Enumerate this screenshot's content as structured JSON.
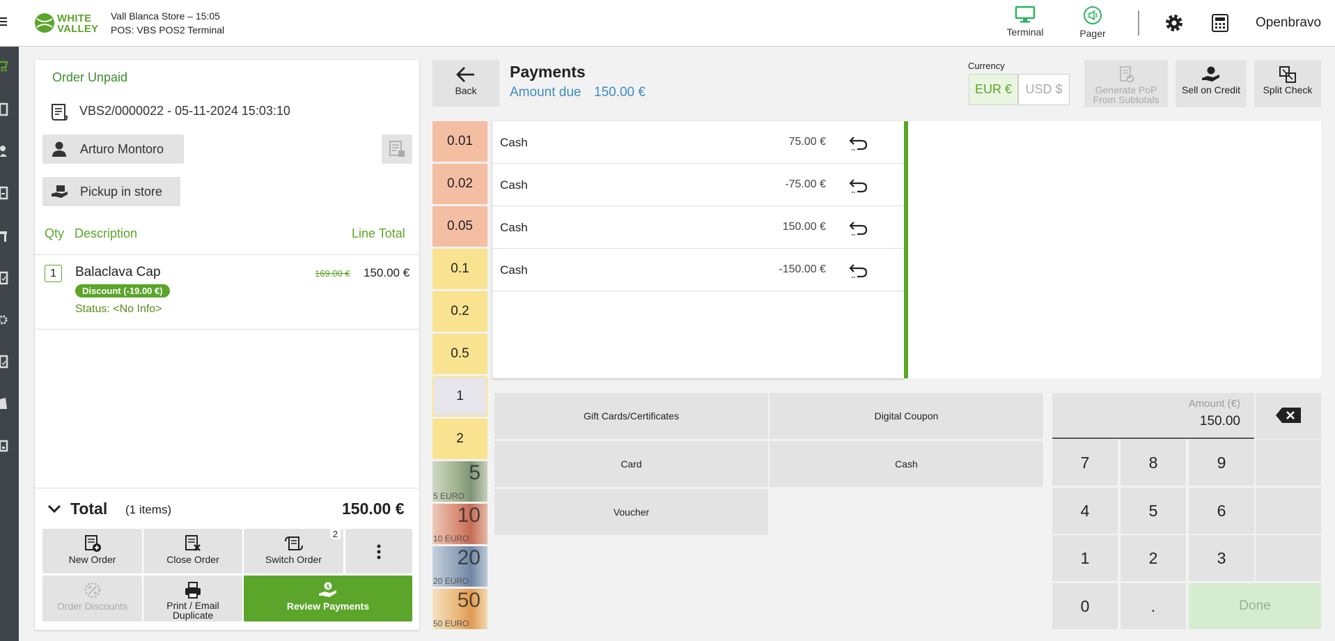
{
  "header": {
    "logo_line1": "WHITE",
    "logo_line2": "VALLEY",
    "store": "Vall Blanca Store – 15:05",
    "pos": "POS: VBS POS2 Terminal",
    "terminal_label": "Terminal",
    "pager_label": "Pager",
    "user": "Openbravo"
  },
  "order": {
    "status": "Order Unpaid",
    "document": "VBS2/0000022 - 05-11-2024 15:03:10",
    "customer": "Arturo Montoro",
    "delivery": "Pickup in store",
    "columns": {
      "qty": "Qty",
      "description": "Description",
      "total": "Line Total"
    },
    "lines": [
      {
        "qty": "1",
        "name": "Balaclava Cap",
        "old_price": "169.00 €",
        "price": "150.00 €",
        "discount": "Discount (-19.00 €)",
        "status": "Status: <No Info>"
      }
    ],
    "total_label": "Total",
    "total_items": "(1 items)",
    "total_amount": "150.00 €",
    "buttons": {
      "new_order": "New Order",
      "close_order": "Close Order",
      "switch_order": "Switch Order",
      "switch_badge": "2",
      "order_discounts": "Order Discounts",
      "print_line1": "Print / Email",
      "print_line2": "Duplicate",
      "review_payments": "Review Payments"
    }
  },
  "payment": {
    "back": "Back",
    "title": "Payments",
    "due_label": "Amount due",
    "due_amount": "150.00 €",
    "currency_label": "Currency",
    "currency_selected": "EUR €",
    "currency_other": "USD $",
    "pop_line1": "Generate PoP",
    "pop_line2": "From Subtotals",
    "sell_on_credit": "Sell on Credit",
    "split_check": "Split Check",
    "coins": [
      "0.01",
      "0.02",
      "0.05",
      "0.1",
      "0.2",
      "0.5",
      "1",
      "2"
    ],
    "notes": [
      "5",
      "10",
      "20",
      "50"
    ],
    "note_currency": "EURO",
    "rows": [
      {
        "method": "Cash",
        "amount": "75.00 €"
      },
      {
        "method": "Cash",
        "amount": "-75.00 €"
      },
      {
        "method": "Cash",
        "amount": "150.00 €"
      },
      {
        "method": "Cash",
        "amount": "-150.00 €"
      }
    ],
    "methods": {
      "gift": "Gift Cards/Certificates",
      "digital": "Digital Coupon",
      "card": "Card",
      "cash": "Cash",
      "voucher": "Voucher"
    },
    "amount_label": "Amount (€)",
    "amount_value": "150.00",
    "keys": [
      "7",
      "8",
      "9",
      "4",
      "5",
      "6",
      "1",
      "2",
      "3",
      "0",
      "."
    ],
    "done": "Done"
  },
  "colors": {
    "brand_green": "#5ba52a",
    "due_blue": "#3d8cc6",
    "rail": "#3f454a"
  }
}
